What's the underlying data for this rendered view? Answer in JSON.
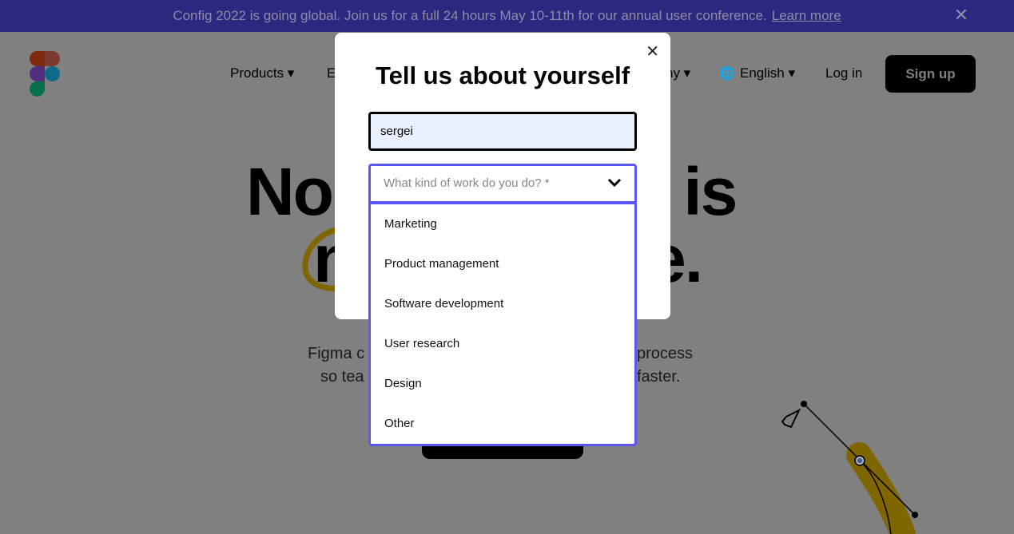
{
  "banner": {
    "text": "Config 2022 is going global. Join us for a full 24 hours May 10-11th for our annual user conference.",
    "link": "Learn more",
    "close_icon": "close-icon"
  },
  "nav": {
    "products": "Products ▾",
    "partial_e": "E",
    "partial_ny": "ny ▾",
    "language": "English ▾",
    "login": "Log in",
    "signup": "Sign up"
  },
  "hero": {
    "frag1": "No",
    "frag2": "t is",
    "frag3": "n",
    "frag4": "e.",
    "sub1a": "Figma c",
    "sub1b": "process",
    "sub2a": "so tea",
    "sub2b": "faster."
  },
  "modal": {
    "title": "Tell us about yourself",
    "name_value": "sergei",
    "work_placeholder": "What kind of work do you do? *",
    "options": [
      "Marketing",
      "Product management",
      "Software development",
      "User research",
      "Design",
      "Other"
    ]
  },
  "colors": {
    "banner": "#2c2880",
    "accent": "#5b55f5",
    "overlay": "#808080",
    "highlight": "#7f6600"
  }
}
